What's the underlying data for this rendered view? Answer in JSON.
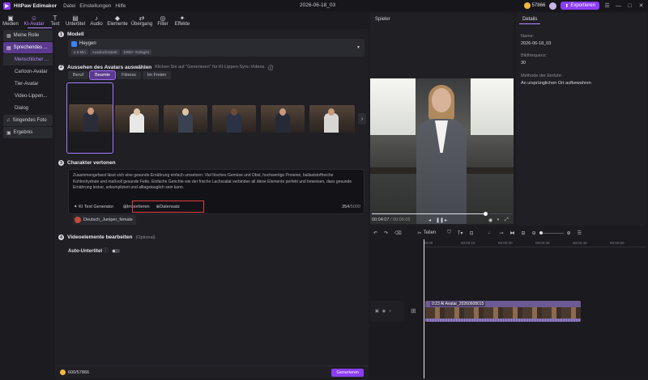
{
  "app": {
    "name": "HitPaw Edimakor",
    "doc_title": "2026-06-18_03",
    "menus": [
      "Datei",
      "Einstellungen",
      "Hilfe"
    ],
    "credits": "57866",
    "export_label": "Exportieren"
  },
  "toolbar": {
    "items": [
      {
        "label": "Medien",
        "icon": "media-icon"
      },
      {
        "label": "KI-Avatar",
        "icon": "ai-avatar-icon"
      },
      {
        "label": "Text",
        "icon": "text-icon"
      },
      {
        "label": "Untertitel",
        "icon": "subtitle-icon"
      },
      {
        "label": "Audio",
        "icon": "audio-icon"
      },
      {
        "label": "Elemente",
        "icon": "elements-icon"
      },
      {
        "label": "Übergang",
        "icon": "transition-icon"
      },
      {
        "label": "Filter",
        "icon": "filter-icon"
      },
      {
        "label": "Effekte",
        "icon": "effects-icon"
      }
    ]
  },
  "leftnav": {
    "my_roles": "Meine Rolle",
    "speaking": "Sprechendes ...",
    "subs": [
      "Menschlicher ...",
      "Cartoon-Avatar",
      "Tier-Avatar",
      "Video-Lippen...",
      "Dialog"
    ],
    "singing": "Singendes Foto",
    "result": "Ergebnis"
  },
  "model": {
    "title": "Modell",
    "name": "Heygen",
    "tags": [
      "≤ 5 Min",
      "Ausdrucksstark",
      "1000+ Vorlagen"
    ]
  },
  "choose": {
    "title": "Aussehen des Avatars auswählen",
    "hint": "Klicken Sie auf \"Generieren\" für KI-Lippen-Sync-Videos.",
    "tabs": [
      "Beruf",
      "Beamte",
      "Fitness",
      "Im Freien"
    ]
  },
  "voice_section": {
    "title": "Charakter vertonen",
    "text": "Zusammengefasst lässt sich eine gesunde Ernährung einfach umsetzen: Viel frisches Gemüse und Obst, hochwertige Proteine, ballaststoffreiche Kohlenhydrate und maßvoll gesunde Fette. Einfache Gerichte wie der frische Lachssalat verbinden all diese Elemente perfekt und beweisen, dass gesunde Ernährung lecker, unkompliziert und alltagstauglich sein kann.",
    "ai_gen": "KI Text Generator",
    "import": "Importieren",
    "dataset": "Datensatz",
    "count": "354",
    "limit": "/5000",
    "voice_name": "Deutsch_Juniper_female"
  },
  "edit_section": {
    "title": "Videoelemente bearbeiten",
    "optional": "(Optional)",
    "auto_sub": "Auto-Untertitel"
  },
  "bottom": {
    "credits": "600/57866",
    "generate": "Generieren"
  },
  "player": {
    "title": "Spieler",
    "time": "00:04:07",
    "total": "/ 00:05:05"
  },
  "details": {
    "tab": "Details",
    "name_label": "Name:",
    "name_val": "2026-06-18_03",
    "fps_label": "Bildfrequenz:",
    "fps_val": "30",
    "method_label": "Methode der Einfuhr:",
    "method_val": "An ursprünglichen Ort aufbewahren"
  },
  "timeline": {
    "split": "Teilen",
    "ticks": [
      "00:00",
      "00:00:10",
      "00:00:20",
      "00:00:30",
      "00:00:40",
      "00:00:50"
    ],
    "clip_label": "0:23 AI Avatar_20260608015"
  }
}
